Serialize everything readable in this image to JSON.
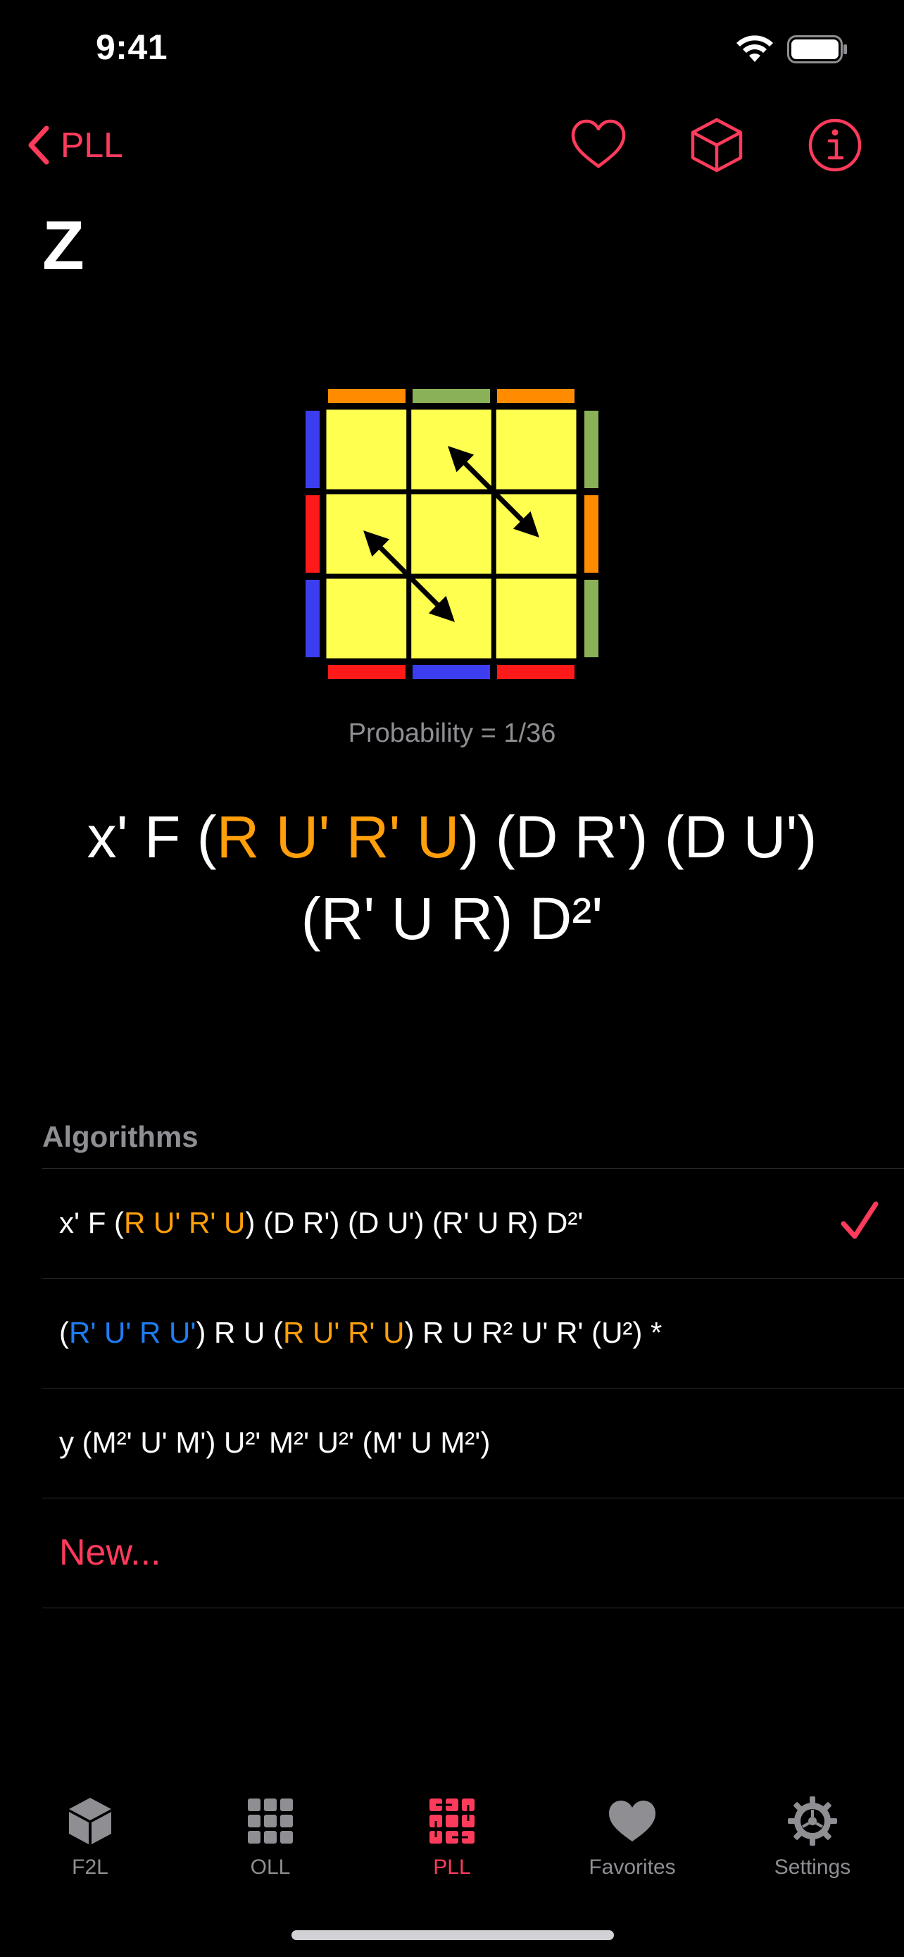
{
  "status": {
    "time": "9:41"
  },
  "nav": {
    "back_label": "PLL",
    "title": "Z"
  },
  "case": {
    "probability": "Probability = 1/36",
    "main_alg": {
      "p1": "x' F (",
      "p2": "R U' R' U",
      "p3": ") (D R') (D U')",
      "p4": "(R' U R) D²'"
    }
  },
  "algorithms": {
    "header": "Algorithms",
    "items": [
      {
        "a1": "x' F (",
        "a2": "R U' R' U",
        "a3": ") (D R') (D U') (R' U R) D²'",
        "selected": true
      },
      {
        "b1": "(",
        "b2": "R' U' R U'",
        "b3": ") R U (",
        "b4": "R U' R' U",
        "b5": ") R U R² U' R' (U²) *"
      },
      {
        "c1": "y (M²' U' M') U²' M²' U²' (M' U M²')"
      }
    ],
    "new_label": "New..."
  },
  "tabs": [
    {
      "label": "F2L"
    },
    {
      "label": "OLL"
    },
    {
      "label": "PLL",
      "active": true
    },
    {
      "label": "Favorites"
    },
    {
      "label": "Settings"
    }
  ],
  "colors": {
    "accent": "#ff3b5c",
    "highlight_orange": "#ff9f0a",
    "highlight_blue": "#1e7cf2",
    "sticker_yellow": "#ffff4f"
  },
  "icons": [
    "chevron-left-icon",
    "heart-icon",
    "cube-icon",
    "info-icon",
    "wifi-icon",
    "battery-icon"
  ]
}
